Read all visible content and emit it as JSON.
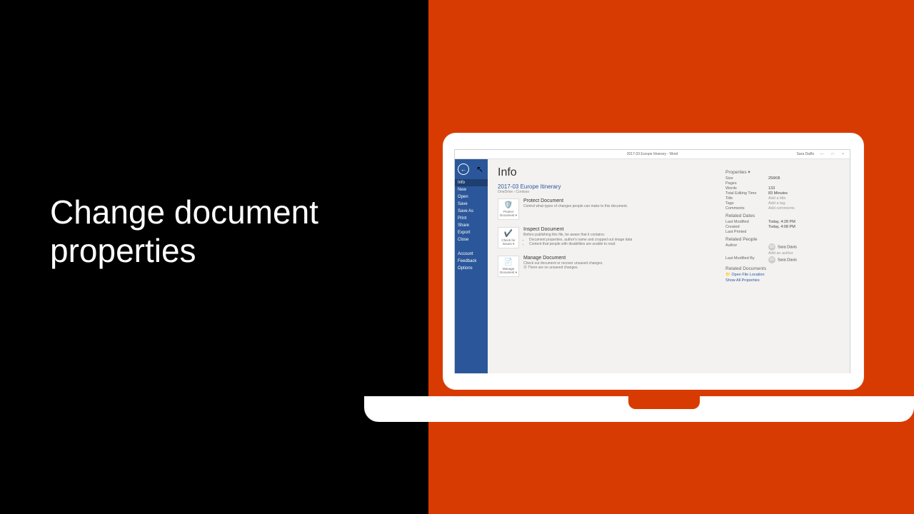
{
  "headline": "Change document\nproperties",
  "app": {
    "title": "2017-03 Europe Itinerary - Word",
    "user": "Sara Davis",
    "help": "?",
    "minimize": "—",
    "restore": "□",
    "close": "×"
  },
  "sidebar": {
    "back": "←",
    "items": [
      "Info",
      "New",
      "Open",
      "Save",
      "Save As",
      "Print",
      "Share",
      "Export",
      "Close"
    ],
    "footer": [
      "Account",
      "Feedback",
      "Options"
    ]
  },
  "page": {
    "heading": "Info",
    "document_name": "2017-03 Europe Itinerary",
    "document_path": "OneDrive › Contoso"
  },
  "tiles": {
    "protect": {
      "icon": "🛡️",
      "icon_label": "Protect Document ▾",
      "title": "Protect Document",
      "desc": "Control what types of changes people can make to this document."
    },
    "inspect": {
      "icon": "✔️",
      "icon_label": "Check for Issues ▾",
      "title": "Inspect Document",
      "desc": "Before publishing this file, be aware that it contains:",
      "bullets": [
        "Document properties, author's name and cropped out image data",
        "Content that people with disabilities are unable to read"
      ]
    },
    "manage": {
      "icon": "📄",
      "icon_label": "Manage Document ▾",
      "title": "Manage Document",
      "desc": "Check out document or recover unsaved changes.",
      "sub": "⦿ There are no unsaved changes."
    }
  },
  "properties": {
    "heading": "Properties ▾",
    "rows": [
      {
        "k": "Size",
        "v": "256KB"
      },
      {
        "k": "Pages",
        "v": ""
      },
      {
        "k": "Words",
        "v": "133"
      },
      {
        "k": "Total Editing Time",
        "v": "83 Minutes"
      },
      {
        "k": "Title",
        "v": "Add a title",
        "ph": true
      },
      {
        "k": "Tags",
        "v": "Add a tag",
        "ph": true
      },
      {
        "k": "Comments",
        "v": "Add comments",
        "ph": true
      }
    ]
  },
  "dates": {
    "heading": "Related Dates",
    "rows": [
      {
        "k": "Last Modified",
        "v": "Today, 4:28 PM"
      },
      {
        "k": "Created",
        "v": "Today, 4:08 PM"
      },
      {
        "k": "Last Printed",
        "v": ""
      }
    ]
  },
  "people": {
    "heading": "Related People",
    "author_label": "Author",
    "author": "Sara Davis",
    "add_author": "Add an author",
    "modified_label": "Last Modified By",
    "modified_by": "Sara Davis",
    "initials": "SD"
  },
  "docs": {
    "heading": "Related Documents",
    "open_location": "📁 Open File Location",
    "show_all": "Show All Properties"
  }
}
